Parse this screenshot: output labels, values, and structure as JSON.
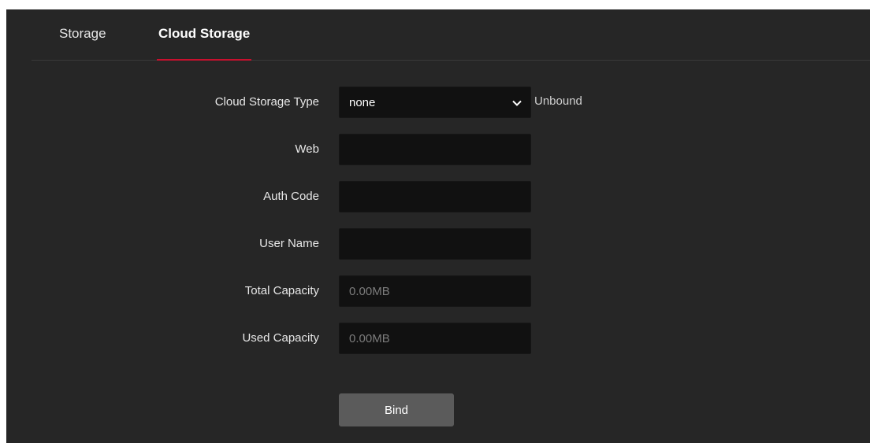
{
  "tabs": [
    {
      "label": "Storage",
      "active": false
    },
    {
      "label": "Cloud Storage",
      "active": true
    }
  ],
  "accent_color": "#c8102e",
  "form": {
    "cloud_storage_type": {
      "label": "Cloud Storage Type",
      "value": "none",
      "status": "Unbound",
      "icon": "chevron-down-icon"
    },
    "web": {
      "label": "Web",
      "value": ""
    },
    "auth_code": {
      "label": "Auth Code",
      "value": ""
    },
    "user_name": {
      "label": "User Name",
      "value": ""
    },
    "total_capacity": {
      "label": "Total Capacity",
      "value": "0.00MB"
    },
    "used_capacity": {
      "label": "Used Capacity",
      "value": "0.00MB"
    }
  },
  "bind_button": {
    "label": "Bind"
  }
}
